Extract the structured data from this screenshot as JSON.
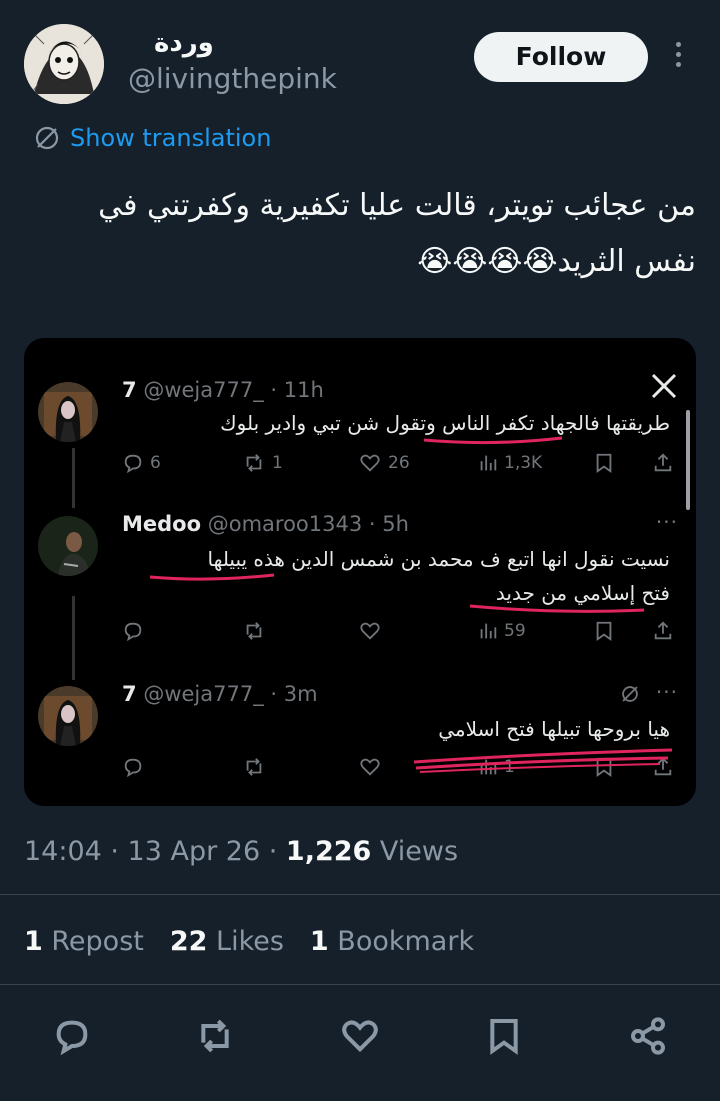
{
  "author": {
    "name": "وردة",
    "handle": "@livingthepink"
  },
  "follow_label": "Follow",
  "translation_label": "Show translation",
  "tweet": {
    "line1": "من عجائب تويتر، قالت عليا تكفيرية وكفرتني في",
    "line2": "نفس الثريد😭😭😭😭"
  },
  "embedded": {
    "replies": [
      {
        "name": "7",
        "handle": "@weja777_",
        "time": "· 11h",
        "text": "طريقتها فالجهاد تكفر الناس وتقول شن تبي وادير بلوك",
        "replies": "6",
        "reposts": "1",
        "likes": "26",
        "views": "1,3K"
      },
      {
        "name": "Medoo",
        "handle": "@omaroo1343",
        "time": "· 5h",
        "text_line1": "نسيت نقول انها اتبع ف محمد بن شمس الدين هذه يبيلها",
        "text_line2": "فتح إسلامي من جديد",
        "replies": "",
        "reposts": "",
        "likes": "",
        "views": "59"
      },
      {
        "name": "7",
        "handle": "@weja777_",
        "time": "· 3m",
        "text": "هيا بروحها تبيلها فتح اسلامي",
        "views": "1"
      }
    ],
    "more_label": "···"
  },
  "meta": {
    "time": "14:04 · 13 Apr 26 · ",
    "views_count": "1,226",
    "views_label": " Views"
  },
  "stats": {
    "reposts_count": "1",
    "reposts_label": " Repost",
    "likes_count": "22",
    "likes_label": " Likes",
    "bookmarks_count": "1",
    "bookmarks_label": " Bookmark"
  },
  "icons": [
    "reply-icon",
    "repost-icon",
    "like-icon",
    "bookmark-icon",
    "share-icon",
    "x-logo-icon",
    "translate-icon"
  ],
  "colors": {
    "accent": "#1d9bf0",
    "background": "#15202b",
    "card": "#000000",
    "underline": "#e0245e"
  }
}
